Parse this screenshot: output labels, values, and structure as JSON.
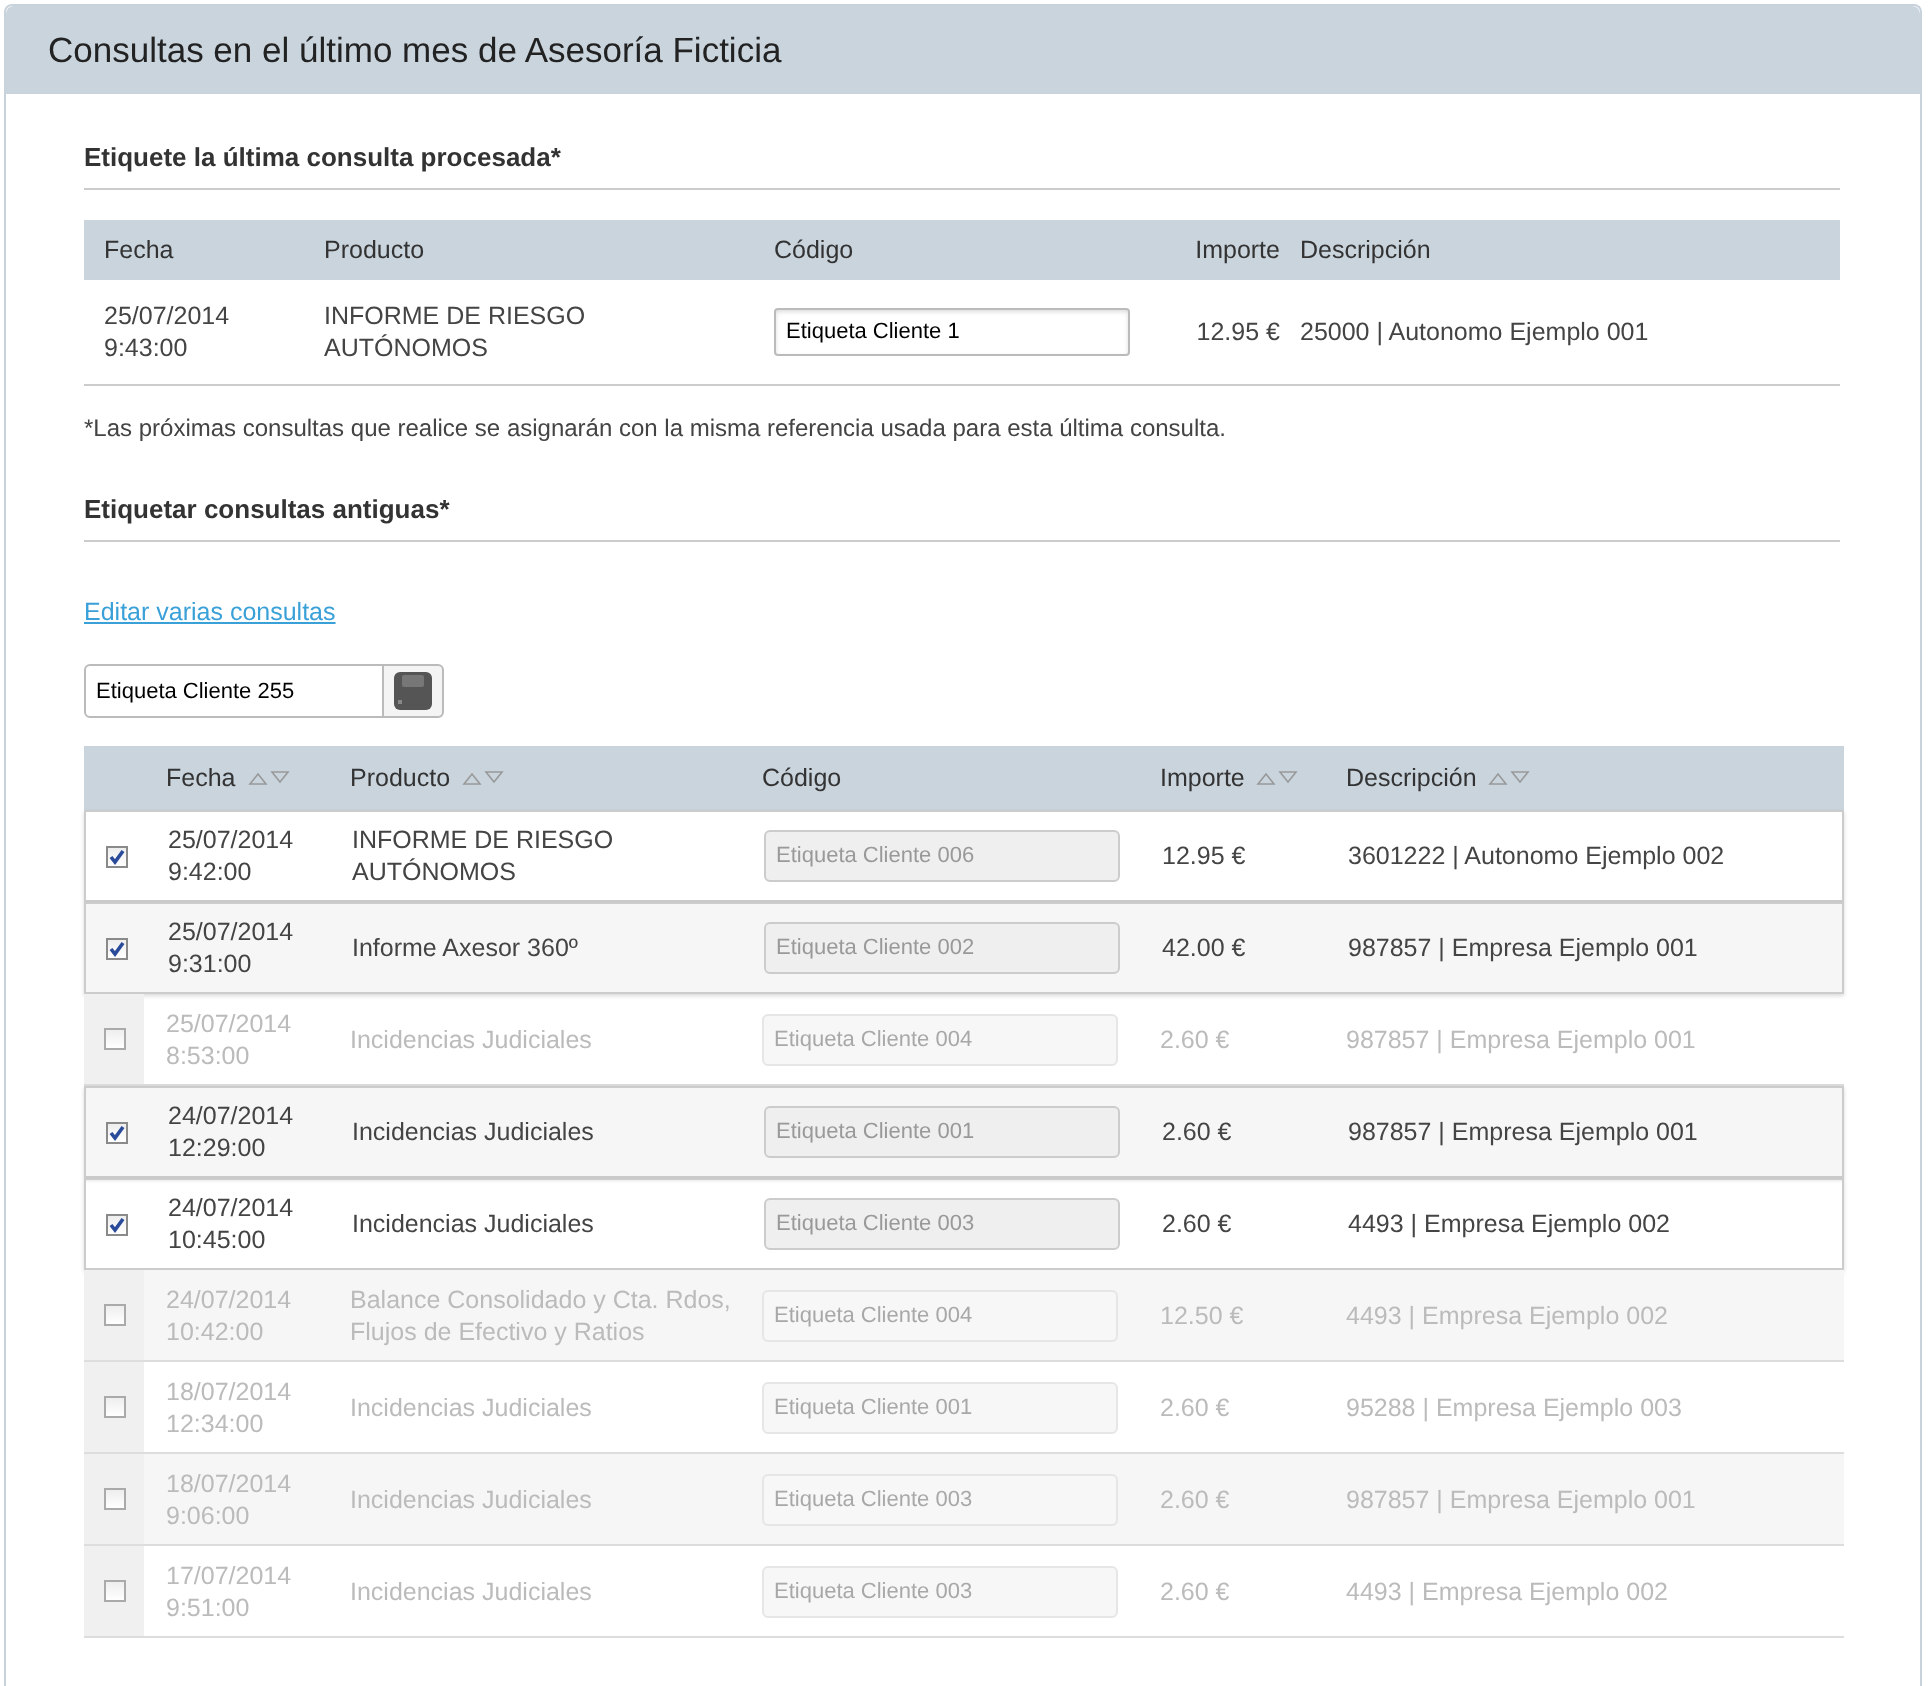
{
  "title": "Consultas en el último mes de Asesoría Ficticia",
  "last_query": {
    "heading": "Etiquete la última consulta procesada*",
    "columns": [
      "Fecha",
      "Producto",
      "Código",
      "Importe",
      "Descripción"
    ],
    "row": {
      "date": "25/07/2014",
      "time": "9:43:00",
      "product": "INFORME DE RIESGO AUTÓNOMOS",
      "code": "Etiqueta Cliente 1",
      "amount": "12.95 €",
      "description": "25000 | Autonomo Ejemplo 001"
    },
    "note": "*Las próximas consultas que realice se asignarán con la misma referencia usada para esta última consulta."
  },
  "old_queries": {
    "heading": "Etiquetar consultas antiguas*",
    "link": "Editar varias consultas",
    "bulk_field": {
      "value": "Etiqueta Cliente 255"
    },
    "columns": [
      {
        "label": "Fecha",
        "sortable": true
      },
      {
        "label": "Producto",
        "sortable": true
      },
      {
        "label": "Código",
        "sortable": false
      },
      {
        "label": "Importe",
        "sortable": true
      },
      {
        "label": "Descripción",
        "sortable": true
      }
    ],
    "rows": [
      {
        "checked": true,
        "date": "25/07/2014",
        "time": "9:42:00",
        "product": "INFORME DE RIESGO AUTÓNOMOS",
        "code": "Etiqueta Cliente 006",
        "amount": "12.95 €",
        "description": "3601222 | Autonomo Ejemplo 002"
      },
      {
        "checked": true,
        "date": "25/07/2014",
        "time": "9:31:00",
        "product": "Informe Axesor 360º",
        "code": "Etiqueta Cliente 002",
        "amount": "42.00 €",
        "description": "987857 | Empresa Ejemplo 001"
      },
      {
        "checked": false,
        "date": "25/07/2014",
        "time": "8:53:00",
        "product": "Incidencias Judiciales",
        "code": "Etiqueta Cliente 004",
        "amount": "2.60 €",
        "description": "987857 | Empresa Ejemplo 001"
      },
      {
        "checked": true,
        "date": "24/07/2014",
        "time": "12:29:00",
        "product": "Incidencias Judiciales",
        "code": "Etiqueta Cliente 001",
        "amount": "2.60 €",
        "description": "987857 | Empresa Ejemplo 001"
      },
      {
        "checked": true,
        "date": "24/07/2014",
        "time": "10:45:00",
        "product": "Incidencias Judiciales",
        "code": "Etiqueta Cliente 003",
        "amount": "2.60 €",
        "description": "4493 | Empresa Ejemplo 002"
      },
      {
        "checked": false,
        "date": "24/07/2014",
        "time": "10:42:00",
        "product": "Balance Consolidado y Cta. Rdos, Flujos de Efectivo y Ratios",
        "code": "Etiqueta Cliente 004",
        "amount": "12.50 €",
        "description": "4493 | Empresa Ejemplo 002"
      },
      {
        "checked": false,
        "date": "18/07/2014",
        "time": "12:34:00",
        "product": "Incidencias Judiciales",
        "code": "Etiqueta Cliente 001",
        "amount": "2.60 €",
        "description": "95288 | Empresa Ejemplo 003"
      },
      {
        "checked": false,
        "date": "18/07/2014",
        "time": "9:06:00",
        "product": "Incidencias Judiciales",
        "code": "Etiqueta Cliente 003",
        "amount": "2.60 €",
        "description": "987857 | Empresa Ejemplo 001"
      },
      {
        "checked": false,
        "date": "17/07/2014",
        "time": "9:51:00",
        "product": "Incidencias Judiciales",
        "code": "Etiqueta Cliente 003",
        "amount": "2.60 €",
        "description": "4493 | Empresa Ejemplo 002"
      }
    ]
  }
}
